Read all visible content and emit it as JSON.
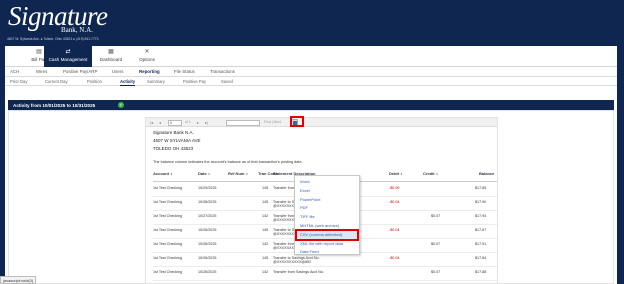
{
  "brand": {
    "name": "Signature",
    "sub": "Bank, N.A.",
    "address": "4607 W. Sylvania Ave.  ●  Toledo, Ohio 43623  ●  (419) 841-7773"
  },
  "topnav": [
    {
      "label": "Bill Pay",
      "icon": "▤",
      "icon_name": "bill-pay-icon"
    },
    {
      "label": "Cash Management",
      "icon": "⇄",
      "icon_name": "cash-management-icon"
    },
    {
      "label": "Dashboard",
      "icon": "▦",
      "icon_name": "dashboard-icon"
    },
    {
      "label": "Options",
      "icon": "✕",
      "icon_name": "options-icon"
    }
  ],
  "subnav": [
    "ACH",
    "Wires",
    "Positive Pay/ARP",
    "Users",
    "Reporting",
    "File Status",
    "Transactions"
  ],
  "subsubnav": [
    "Prior Day",
    "Current Day",
    "Position",
    "Activity",
    "Summary",
    "Positive Pay",
    "Saved"
  ],
  "activity_title": "Activity from 10/01/2025 to 10/31/2025",
  "activity_ok_icon": "✓",
  "toolbar": {
    "first": "|◂",
    "prev": "◂",
    "page": "1",
    "of_text": "of 1",
    "next": "▸",
    "last": "▸|",
    "find_next": "Find | Next",
    "export_icon": "save-icon"
  },
  "report": {
    "company": "Signature Bank N.A.",
    "street": "4607 W SYLVANIA AVE",
    "city": "TOLEDO OH  43623",
    "note": "The balance column indicates the account's balance as of that transaction's posting date."
  },
  "columns": [
    "Account",
    "Date",
    "Ref Num",
    "Tran Code",
    "Statement Description",
    "Debit",
    "Credit",
    "Balance"
  ],
  "rows": [
    {
      "account": "1st Test Checking",
      "date": "10/29/2025",
      "ref": "",
      "code": "145",
      "desc1": "Transfer from Savings Acct No.",
      "desc2": "",
      "debit": "-$0.09",
      "credit": "",
      "balance": "$17.85"
    },
    {
      "account": "1st Test Checking",
      "date": "10/28/2025",
      "ref": "",
      "code": "145",
      "desc1": "Transfer to Savings Acct No.",
      "desc2": "@XXXXXXXXXX@852",
      "debit": "-$0.04",
      "credit": "",
      "balance": "$17.90"
    },
    {
      "account": "1st Test Checking",
      "date": "10/27/2025",
      "ref": "",
      "code": "142",
      "desc1": "Transfer from Savings Acct No.",
      "desc2": "@XXXXXXXXXX@852",
      "debit": "",
      "credit": "$0.07",
      "balance": "$17.94"
    },
    {
      "account": "1st Test Checking",
      "date": "10/26/2025",
      "ref": "",
      "code": "145",
      "desc1": "Transfer to Savings Acct No.",
      "desc2": "@XXXXXXXXXX@852",
      "debit": "-$0.04",
      "credit": "",
      "balance": "$17.87"
    },
    {
      "account": "1st Test Checking",
      "date": "10/26/2025",
      "ref": "",
      "code": "142",
      "desc1": "Transfer from Savings Acct No.",
      "desc2": "@XXXXXXXXXX@852",
      "debit": "",
      "credit": "$0.07",
      "balance": "$17.91"
    },
    {
      "account": "1st Test Checking",
      "date": "10/26/2025",
      "ref": "",
      "code": "145",
      "desc1": "Transfer to Savings Acct No.",
      "desc2": "@XXXXXXXXXX@852",
      "debit": "-$0.04",
      "credit": "",
      "balance": "$17.84"
    },
    {
      "account": "1st Test Checking",
      "date": "10/26/2025",
      "ref": "",
      "code": "142",
      "desc1": "Transfer from Savings Acct No.",
      "desc2": "",
      "debit": "",
      "credit": "$0.07",
      "balance": "$17.88"
    }
  ],
  "export_menu": [
    "Word",
    "Excel",
    "PowerPoint",
    "PDF",
    "TIFF file",
    "MHTML (web archive)",
    "CSV (comma delimited)",
    "XML file with report data",
    "Data Feed"
  ],
  "export_menu_selected": "CSV (comma delimited)",
  "highlight_color": "#e00000",
  "status_text": "javascript:void(0)"
}
